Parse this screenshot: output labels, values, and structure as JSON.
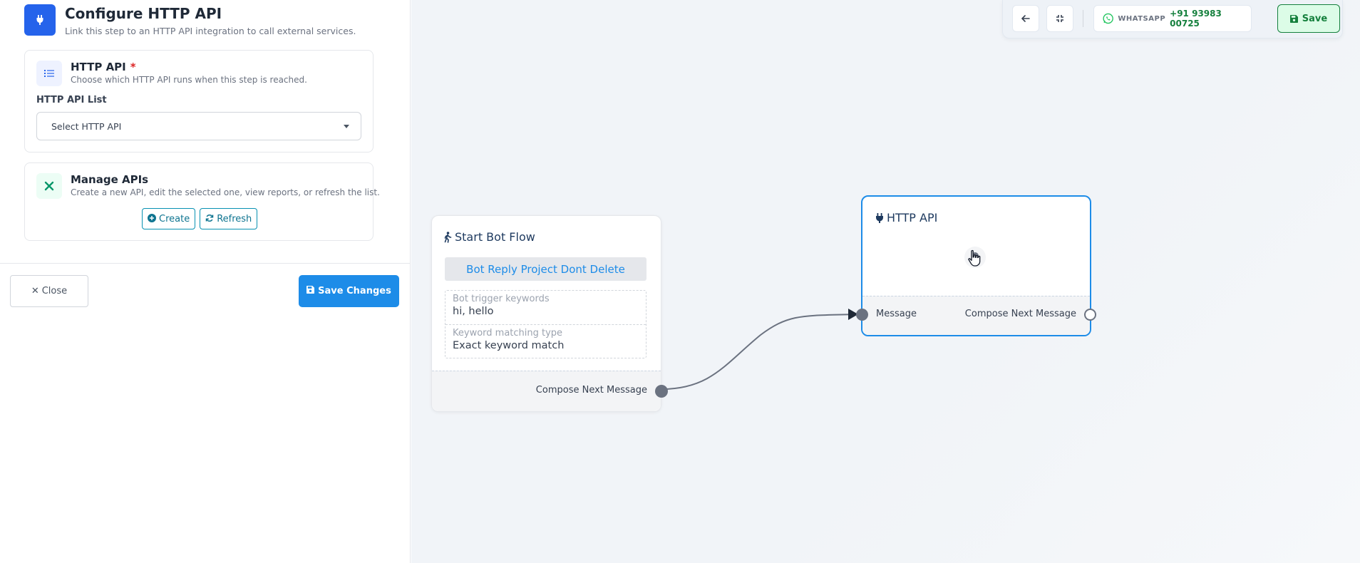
{
  "panel": {
    "header": {
      "title": "Configure HTTP API",
      "subtitle": "Link this step to an HTTP API integration to call external services."
    },
    "http_api_card": {
      "title": "HTTP API",
      "required_mark": "*",
      "description": "Choose which HTTP API runs when this step is reached.",
      "field_label": "HTTP API List",
      "select_value": "Select HTTP API"
    },
    "manage_card": {
      "title": "Manage APIs",
      "description": "Create a new API, edit the selected one, view reports, or refresh the list.",
      "create_label": "Create",
      "refresh_label": "Refresh"
    },
    "close_label": "Close",
    "save_changes_label": "Save Changes"
  },
  "toolbar": {
    "channel": "WHATSAPP",
    "phone": "+91 93983 00725",
    "save_label": "Save"
  },
  "nodes": {
    "start": {
      "title": "Start Bot Flow",
      "project": "Bot Reply Project Dont Delete",
      "keywords_label": "Bot trigger keywords",
      "keywords_value": "hi, hello",
      "matching_label": "Keyword matching type",
      "matching_value": "Exact keyword match",
      "output_label": "Compose Next Message"
    },
    "http": {
      "title": "HTTP API",
      "input_label": "Message",
      "output_label": "Compose Next Message"
    }
  },
  "colors": {
    "primary": "#1d8ce8",
    "header_icon": "#2563eb",
    "whatsapp": "#22c55e",
    "save_green": "#15803d",
    "edge": "#6b7280"
  }
}
